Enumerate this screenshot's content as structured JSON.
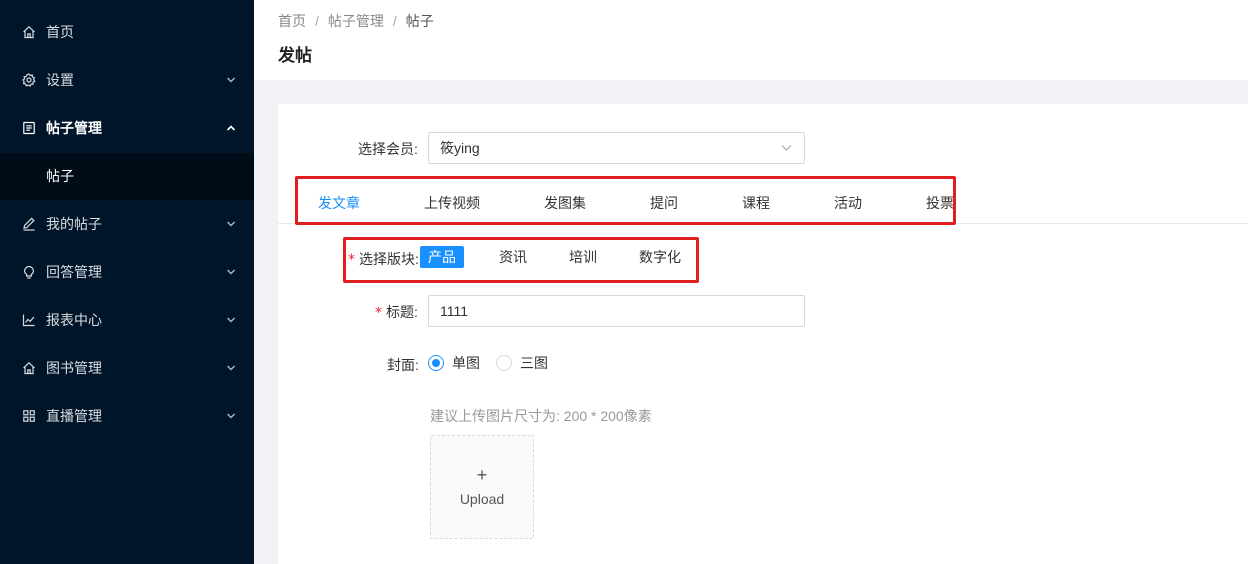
{
  "sidebar": {
    "items": [
      {
        "label": "首页",
        "icon": "home-icon"
      },
      {
        "label": "设置",
        "icon": "gear-icon"
      },
      {
        "label": "帖子管理",
        "icon": "document-icon"
      },
      {
        "label": "帖子"
      },
      {
        "label": "我的帖子",
        "icon": "pencil-icon"
      },
      {
        "label": "回答管理",
        "icon": "lightbulb-icon"
      },
      {
        "label": "报表中心",
        "icon": "line-chart-icon"
      },
      {
        "label": "图书管理",
        "icon": "home-icon"
      },
      {
        "label": "直播管理",
        "icon": "grid-icon"
      }
    ]
  },
  "breadcrumb": {
    "items": [
      "首页",
      "帖子管理",
      "帖子"
    ],
    "separator": "/"
  },
  "page_title": "发帖",
  "form": {
    "member": {
      "label": "选择会员:",
      "value": "筱ying"
    },
    "tabs": [
      "发文章",
      "上传视频",
      "发图集",
      "提问",
      "课程",
      "活动",
      "投票"
    ],
    "active_tab": "发文章",
    "section": {
      "required_mark": "*",
      "label": "选择版块:",
      "options": [
        "产品",
        "资讯",
        "培训",
        "数字化"
      ],
      "selected": "产品"
    },
    "title": {
      "required_mark": "*",
      "label": "标题:",
      "value": "1111"
    },
    "cover": {
      "label": "封面:",
      "options": [
        "单图",
        "三图"
      ],
      "selected": "单图"
    },
    "upload": {
      "hint": "建议上传图片尺寸为: 200 * 200像素",
      "plus": "+",
      "label": "Upload"
    }
  },
  "colors": {
    "sidebar_bg": "#001529",
    "sidebar_sub_bg": "#000c17",
    "accent": "#1890ff",
    "annotation_red": "#e02020"
  }
}
